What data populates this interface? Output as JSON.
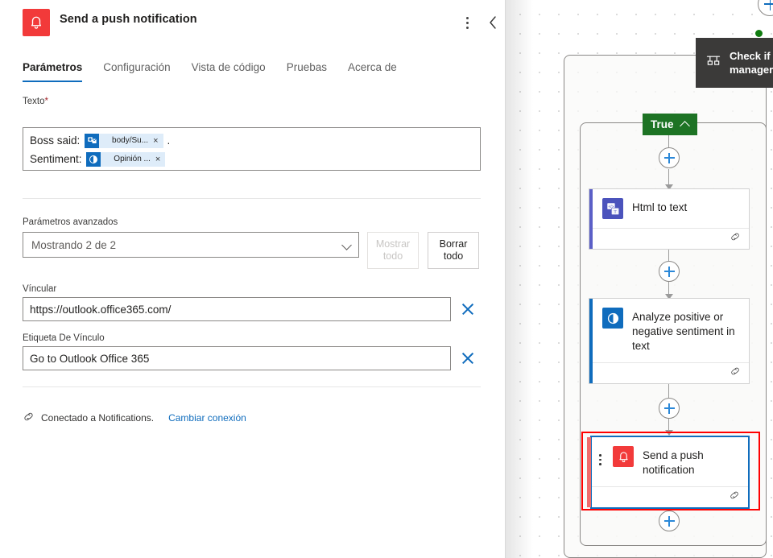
{
  "panel": {
    "app_icon": "bell-icon",
    "title": "Send a push notification",
    "more_icon": "more-vertical-icon",
    "collapse_icon": "chevron-left-icon",
    "tabs": [
      {
        "label": "Parámetros",
        "active": true
      },
      {
        "label": "Configuración",
        "active": false
      },
      {
        "label": "Vista de código",
        "active": false
      },
      {
        "label": "Pruebas",
        "active": false
      },
      {
        "label": "Acerca de",
        "active": false
      }
    ],
    "texto_field": {
      "label": "Texto",
      "required_marker": "*",
      "lines": [
        {
          "prefix": "Boss said: ",
          "token_icon": "outlook-icon",
          "token_text": "body/Su...",
          "token_close": "×",
          "suffix": "."
        },
        {
          "prefix": "Sentiment: ",
          "token_icon": "sentiment-icon",
          "token_text": "Opinión ...",
          "token_close": "×",
          "suffix": ""
        }
      ]
    },
    "advanced": {
      "label": "Parámetros avanzados",
      "select_value": "Mostrando 2 de 2",
      "chevron_icon": "chevron-down-icon",
      "show_all_label": "Mostrar todo",
      "clear_all_label": "Borrar todo"
    },
    "link_field": {
      "label": "Víncular",
      "value": "https://outlook.office365.com/",
      "clear_icon": "close-icon"
    },
    "link_label_field": {
      "label": "Etiqueta De Vínculo",
      "value": "Go to Outlook Office 365",
      "clear_icon": "close-icon"
    },
    "connection": {
      "icon": "link-chain-icon",
      "text": "Conectado a Notifications.",
      "change_link": "Cambiar conexión"
    }
  },
  "canvas": {
    "condition_node": {
      "icon": "condition-icon",
      "label_line1": "Check if i",
      "label_line2": "manager"
    },
    "status_dot": "green-status-dot",
    "top_add_icon": "add-step-icon",
    "branch_badge": {
      "label": "True",
      "chevron_icon": "chevron-up-icon"
    },
    "nodes": [
      {
        "title": "Html to text",
        "icon": "html-to-text-icon",
        "icon_bg": "#4b53bc",
        "accent": "#5b5fc7",
        "footer_icon": "link-chain-icon",
        "selected": false
      },
      {
        "title": "Analyze positive or negative sentiment in text",
        "icon": "sentiment-icon",
        "icon_bg": "#0f6cbd",
        "accent": "#0f6cbd",
        "footer_icon": "link-chain-icon",
        "selected": false
      },
      {
        "title": "Send a push notification",
        "icon": "bell-icon",
        "icon_bg": "#f23a3a",
        "accent": "#f06b6b",
        "footer_icon": "link-chain-icon",
        "selected": true,
        "handle_icon": "drag-handle-icon"
      }
    ],
    "add_buttons": [
      "add-step-icon",
      "add-step-icon",
      "add-step-icon",
      "add-step-icon"
    ]
  },
  "colors": {
    "accent_blue": "#0f6cbd",
    "true_green": "#1d7324",
    "alert_red": "#f23a3a",
    "selection_red": "#ff0000"
  }
}
